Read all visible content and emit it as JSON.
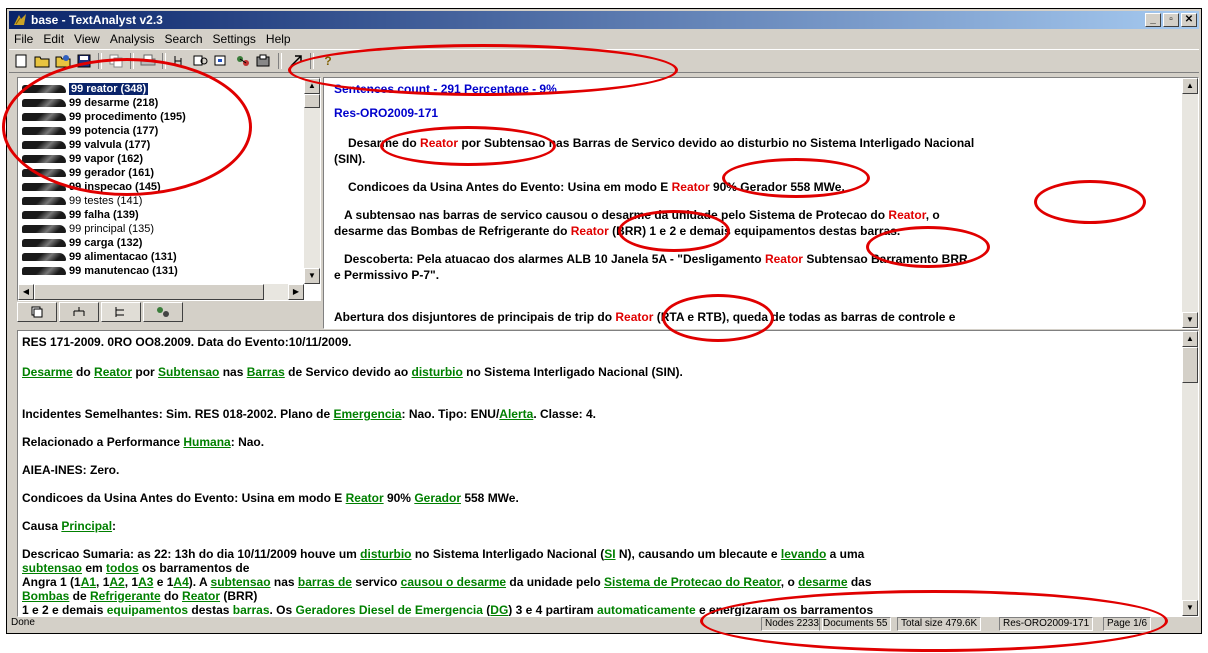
{
  "window": {
    "title": "base - TextAnalyst v2.3"
  },
  "menu": [
    "File",
    "Edit",
    "View",
    "Analysis",
    "Search",
    "Settings",
    "Help"
  ],
  "toolbar_icons": [
    "new-icon",
    "open-icon",
    "open-base-icon",
    "save-icon",
    "copy-icon",
    "print-icon",
    "tree-icon",
    "search-icon",
    "find-icon",
    "semantic-icon",
    "export-icon",
    "arrow-icon",
    "help-icon"
  ],
  "tree": {
    "items": [
      {
        "label": "99 reator (348)",
        "bold": true
      },
      {
        "label": "99 desarme (218)",
        "bold": true
      },
      {
        "label": "99 procedimento (195)",
        "bold": true
      },
      {
        "label": "99 potencia (177)",
        "bold": true
      },
      {
        "label": "99 valvula (177)",
        "bold": true
      },
      {
        "label": "99 vapor (162)",
        "bold": true
      },
      {
        "label": "99 gerador (161)",
        "bold": true
      },
      {
        "label": "99 inspecao (145)",
        "bold": true
      },
      {
        "label": "99 testes (141)",
        "bold": false
      },
      {
        "label": "99 falha (139)",
        "bold": true
      },
      {
        "label": "99 principal (135)",
        "bold": false
      },
      {
        "label": "99 carga (132)",
        "bold": true
      },
      {
        "label": "99 alimentacao (131)",
        "bold": true
      },
      {
        "label": "99 manutencao (131)",
        "bold": true
      }
    ]
  },
  "tabs": [
    "tab-list-icon",
    "tab-tree-icon",
    "tab-hierarchy-icon",
    "tab-semantic-icon"
  ],
  "results": {
    "header": "Sentences count - 291  Percentage - 9%",
    "doc_id": "Res-ORO2009-171",
    "s1a": "Desarme do ",
    "s1b": "Reator",
    "s1c": " por Subtensao nas Barras de Servico devido ao disturbio no Sistema Interligado Nacional",
    "s1d": "(SIN).",
    "s2a": "Condicoes da Usina Antes do Evento: Usina em modo E ",
    "s2b": "Reator",
    "s2c": " 90% Gerador 558 MWe.",
    "s3a": "A subtensao nas barras de servico causou o desarme da unidade pelo Sistema de Protecao do ",
    "s3b": "Reator",
    "s3c": ", o",
    "s3d": "desarme das Bombas de Refrigerante do ",
    "s3e": "Reator",
    "s3f": " (BRR)   1 e 2 e demais equipamentos destas barras.",
    "s4a": "Descoberta: Pela atuacao dos alarmes ALB 10 Janela 5A - \"Desligamento ",
    "s4b": "Reator",
    "s4c": " Subtensao Barramento BRR",
    "s4d": "e Permissivo P-7\".",
    "s5a": "Abertura dos disjuntores de principais de trip do ",
    "s5b": "Reator",
    "s5c": " (RTA e RTB), queda de todas as barras de controle e"
  },
  "doc": {
    "l1": "RES 171-2009. 0RO OO8.2009. Data do Evento:10/11/2009.",
    "l2": [
      "Desarme",
      " do ",
      "Reator",
      " por ",
      "Subtensao",
      " nas ",
      "Barras",
      " de Servico devido ao ",
      "disturbio",
      " no Sistema Interligado Nacional (SIN)."
    ],
    "l3": [
      "Incidentes Semelhantes: Sim. RES 018-2002. Plano de ",
      "Emergencia",
      ": Nao. Tipo: ENU/",
      "Alerta",
      ". Classe: 4."
    ],
    "l4": [
      "Relacionado a Performance ",
      "Humana",
      ": Nao."
    ],
    "l5": "AIEA-INES: Zero.",
    "l6": [
      "Condicoes da Usina Antes do Evento: Usina em modo E ",
      "Reator",
      " 90% ",
      "Gerador",
      " 558 MWe."
    ],
    "l7": [
      "Causa ",
      "Principal",
      ":"
    ],
    "l8": [
      "Descricao Sumaria: as 22: 13h do dia 10/11/2009 houve um ",
      "disturbio",
      " no Sistema Interligado Nacional (",
      "SI",
      " N), causando um blecaute e ",
      "levando",
      " a uma"
    ],
    "l9": [
      "subtensao",
      " em ",
      "todos",
      " os barramentos de"
    ],
    "l10": [
      "Angra 1 (1",
      "A1",
      ", 1",
      "A2",
      ", 1",
      "A3",
      " e 1",
      "A4",
      "). A ",
      "subtensao",
      " nas ",
      "barras de",
      " servico ",
      "causou o desarme",
      " da unidade pelo ",
      "Sistema de Protecao do Reator",
      ", o ",
      "desarme",
      " das"
    ],
    "l11": [
      "Bombas",
      " de ",
      "Refrigerante",
      " do ",
      "Reator",
      " (BRR)"
    ],
    "l12": [
      "1 e 2 e demais ",
      "equipamentos",
      " destas ",
      "barras",
      ". Os ",
      "Geradores Diesel de Emergencia",
      " (",
      "DG",
      ") 3 e 4 partiram ",
      "automaticamente",
      " e energizaram os barramentos"
    ]
  },
  "status": {
    "left": "Done",
    "nodes": "Nodes 2233",
    "documents": "Documents 55",
    "total": "Total size 479.6K",
    "doc": "Res-ORO2009-171",
    "page": "Page 1/6"
  }
}
